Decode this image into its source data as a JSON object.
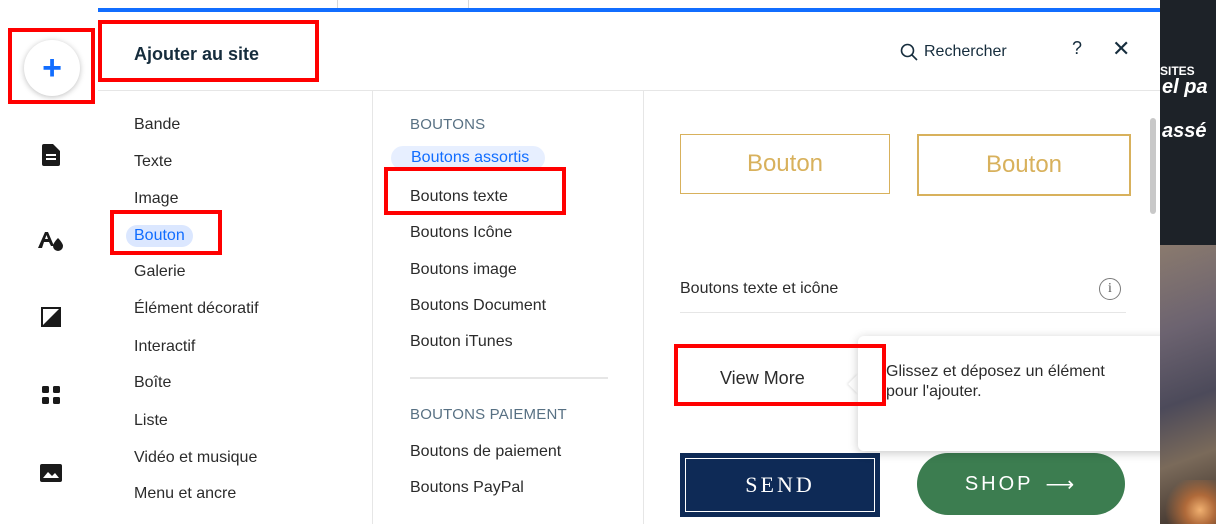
{
  "panel": {
    "title": "Ajouter au site",
    "search_label": "Rechercher",
    "help_label": "?",
    "close_label": "✕"
  },
  "categories": [
    {
      "label": "Bande"
    },
    {
      "label": "Texte"
    },
    {
      "label": "Image"
    },
    {
      "label": "Bouton"
    },
    {
      "label": "Galerie"
    },
    {
      "label": "Élément décoratif"
    },
    {
      "label": "Interactif"
    },
    {
      "label": "Boîte"
    },
    {
      "label": "Liste"
    },
    {
      "label": "Vidéo et musique"
    },
    {
      "label": "Menu et ancre"
    }
  ],
  "subcategories": {
    "group1_title": "BOUTONS",
    "group1": [
      {
        "label": "Boutons assortis"
      },
      {
        "label": "Boutons texte"
      },
      {
        "label": "Boutons Icône"
      },
      {
        "label": "Boutons image"
      },
      {
        "label": "Boutons Document"
      },
      {
        "label": "Bouton iTunes"
      }
    ],
    "group2_title": "BOUTONS PAIEMENT",
    "group2": [
      {
        "label": "Boutons de paiement"
      },
      {
        "label": "Boutons PayPal"
      }
    ]
  },
  "preview": {
    "button1_label": "Bouton",
    "button2_label": "Bouton",
    "section_label": "Boutons texte et icône",
    "info_label": "i",
    "view_more_label": "View More",
    "send_label": "SEND",
    "shop_label": "SHOP",
    "shop_arrow": "⟶"
  },
  "tooltip": {
    "text_line1": "Glissez et déposez un élément",
    "text_line2": "pour l'ajouter."
  },
  "site": {
    "sites_label": "SITES",
    "text1": "el pa",
    "text2": "assé"
  },
  "colors": {
    "accent": "#116dff",
    "gold": "#d8b15c",
    "send_bg": "#0e2a56",
    "shop_bg": "#3c7d50",
    "annotation": "#ff0000"
  },
  "icons": {
    "add": "plus-icon",
    "pages": "page-icon",
    "design": "theme-icon",
    "background": "background-icon",
    "apps": "apps-grid-icon",
    "media": "image-icon",
    "search": "search-icon",
    "info": "info-icon"
  }
}
